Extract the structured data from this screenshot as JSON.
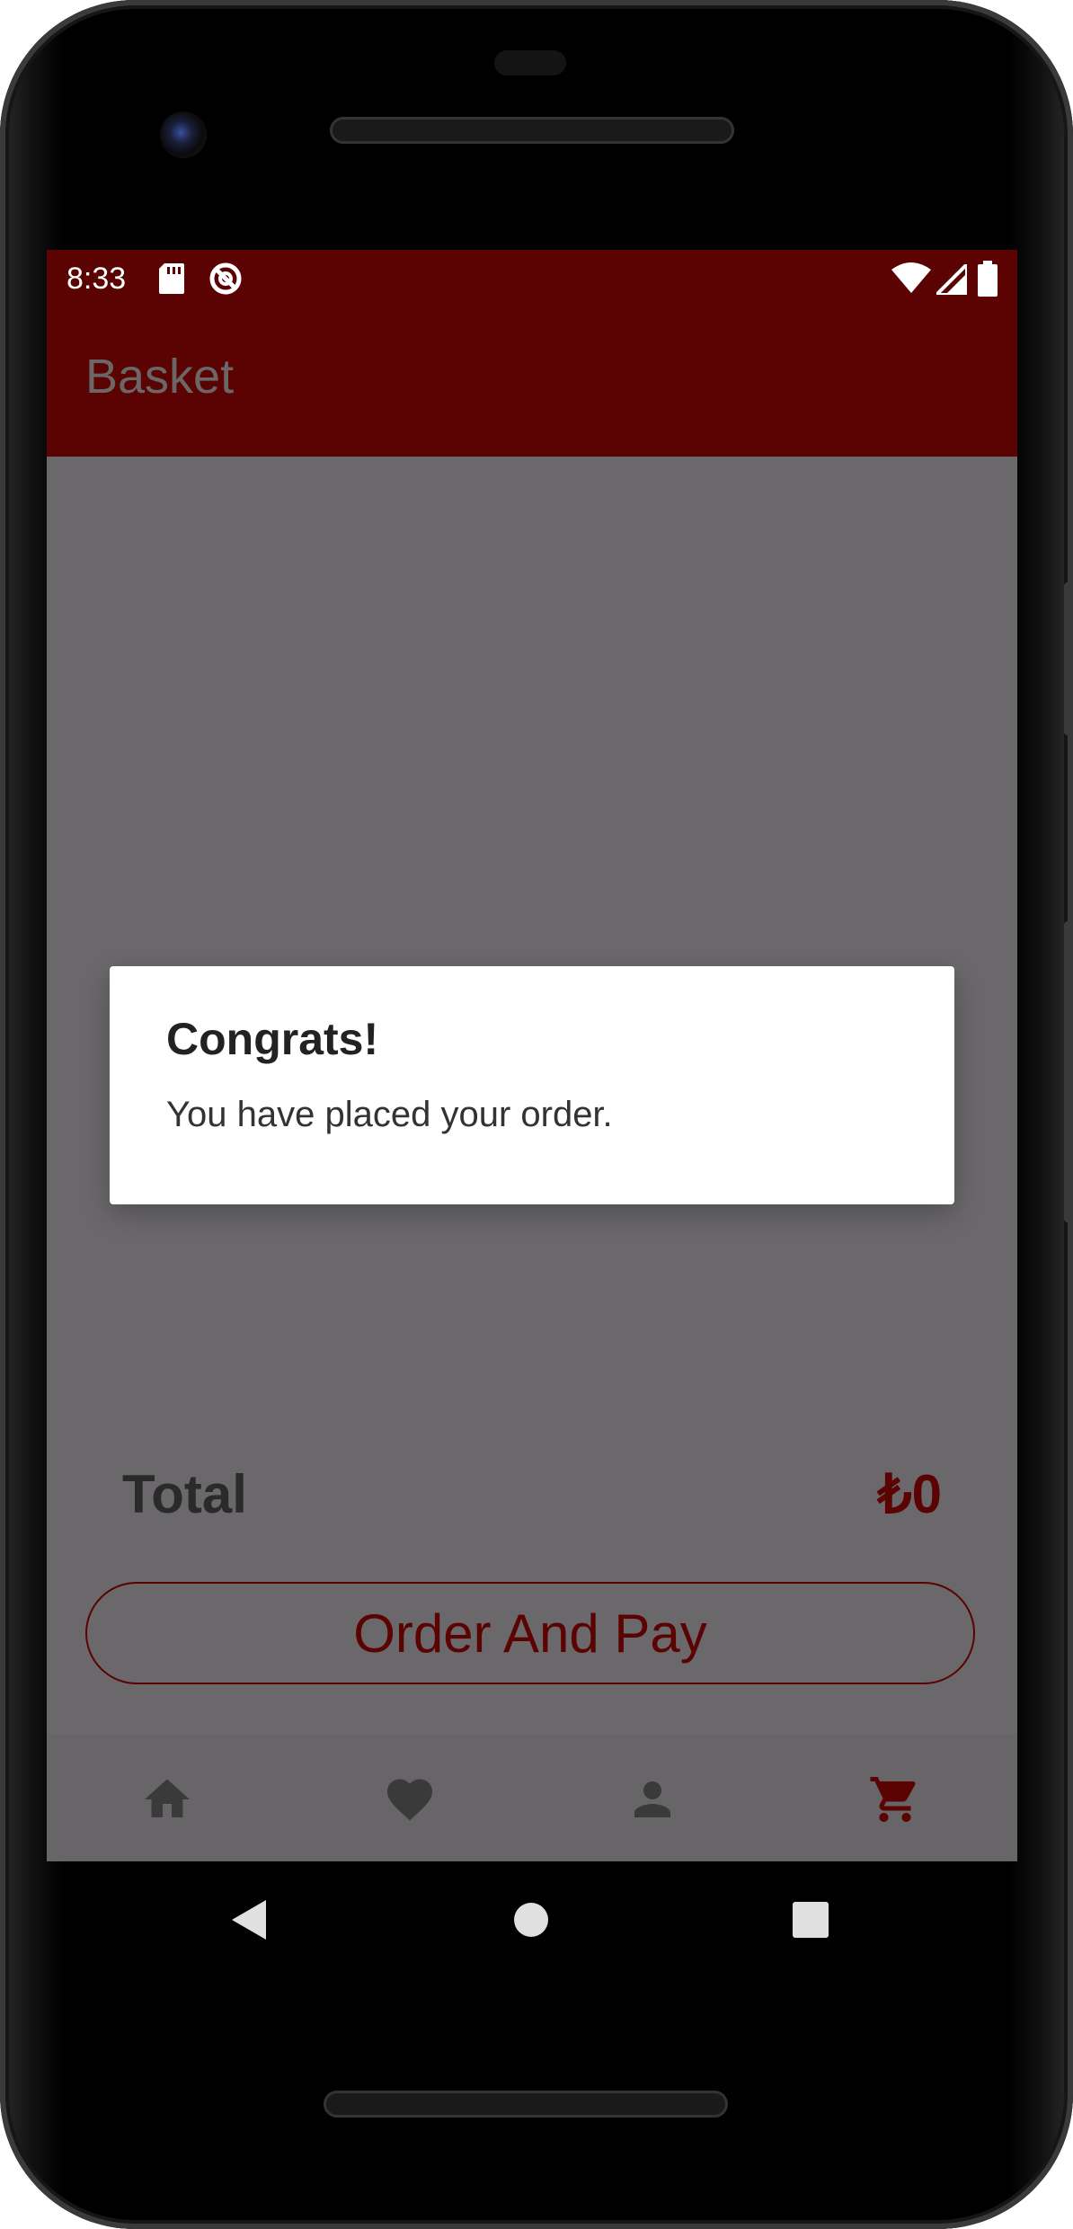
{
  "statusbar": {
    "time": "8:33"
  },
  "appbar": {
    "title": "Basket"
  },
  "basket": {
    "total_label": "Total",
    "total_value": "₺0",
    "order_button_label": "Order And Pay"
  },
  "dialog": {
    "title": "Congrats!",
    "message": "You have placed your order."
  },
  "bottom_nav": {
    "items": [
      "home-icon",
      "favorite-icon",
      "profile-icon",
      "cart-icon"
    ],
    "active": "cart-icon"
  },
  "colors": {
    "primary": "#5b0202",
    "scrim": "#6a686b",
    "icon_inactive": "#3a3a3a"
  }
}
